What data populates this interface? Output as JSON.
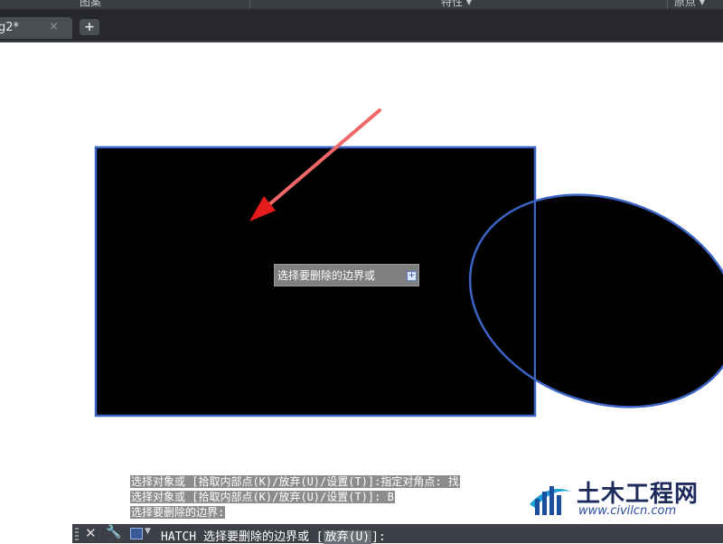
{
  "ribbon": {
    "panels": [
      "图案",
      "特性 ▾",
      "原点 ▾"
    ]
  },
  "tabs": {
    "active_title": "g2*",
    "close_glyph": "×",
    "add_glyph": "+"
  },
  "tooltip": {
    "text": "选择要删除的边界或",
    "button_glyph": "+"
  },
  "history": [
    "选择对象或 [拾取内部点(K)/放弃(U)/设置(T)]:指定对角点: 找",
    "选择对象或 [拾取内部点(K)/放弃(U)/设置(T)]: B",
    "选择要删除的边界:"
  ],
  "command": {
    "prefix": "HATCH 选择要删除的边界或 [",
    "option": "放弃(U)",
    "suffix": "]:"
  },
  "logo": {
    "name": "土木工程网",
    "url": "www.civilcn.com"
  },
  "colors": {
    "fill": "#000000",
    "boundary": "#3b64c4",
    "arrow": "#e31b1b"
  }
}
